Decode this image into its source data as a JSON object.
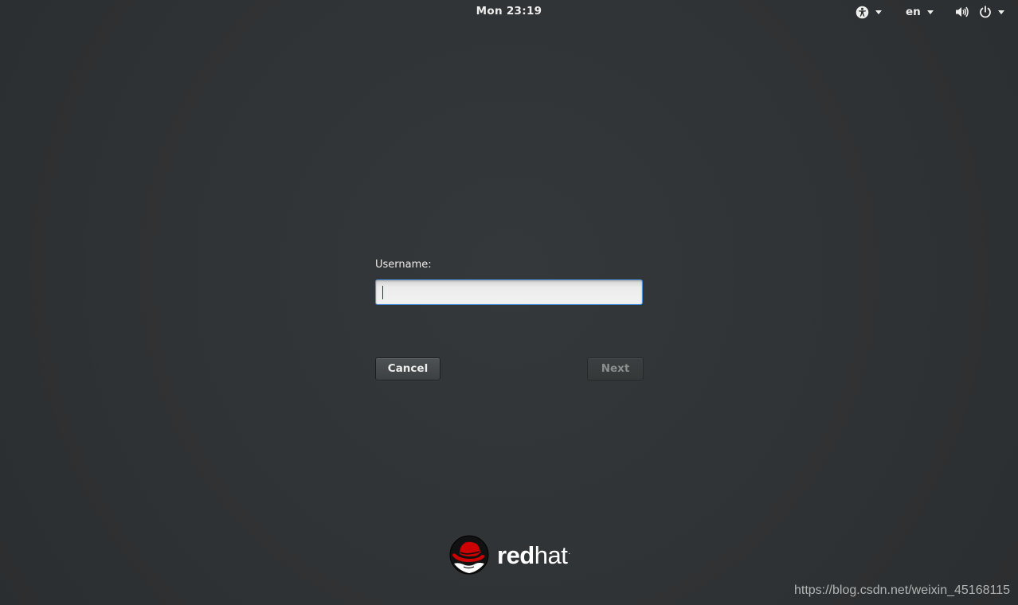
{
  "topbar": {
    "clock": "Mon 23:19",
    "language": "en",
    "accessibility_icon": "accessibility-icon",
    "volume_icon": "volume-icon",
    "power_icon": "power-icon"
  },
  "login": {
    "username_label": "Username:",
    "username_value": "",
    "username_placeholder": "",
    "cancel_label": "Cancel",
    "next_label": "Next"
  },
  "branding": {
    "logo_text_bold": "red",
    "logo_text_light": "hat",
    "logo_trademark": ".",
    "logo_accent_color": "#cc0000"
  },
  "watermark": "https://blog.csdn.net/weixin_45168115"
}
